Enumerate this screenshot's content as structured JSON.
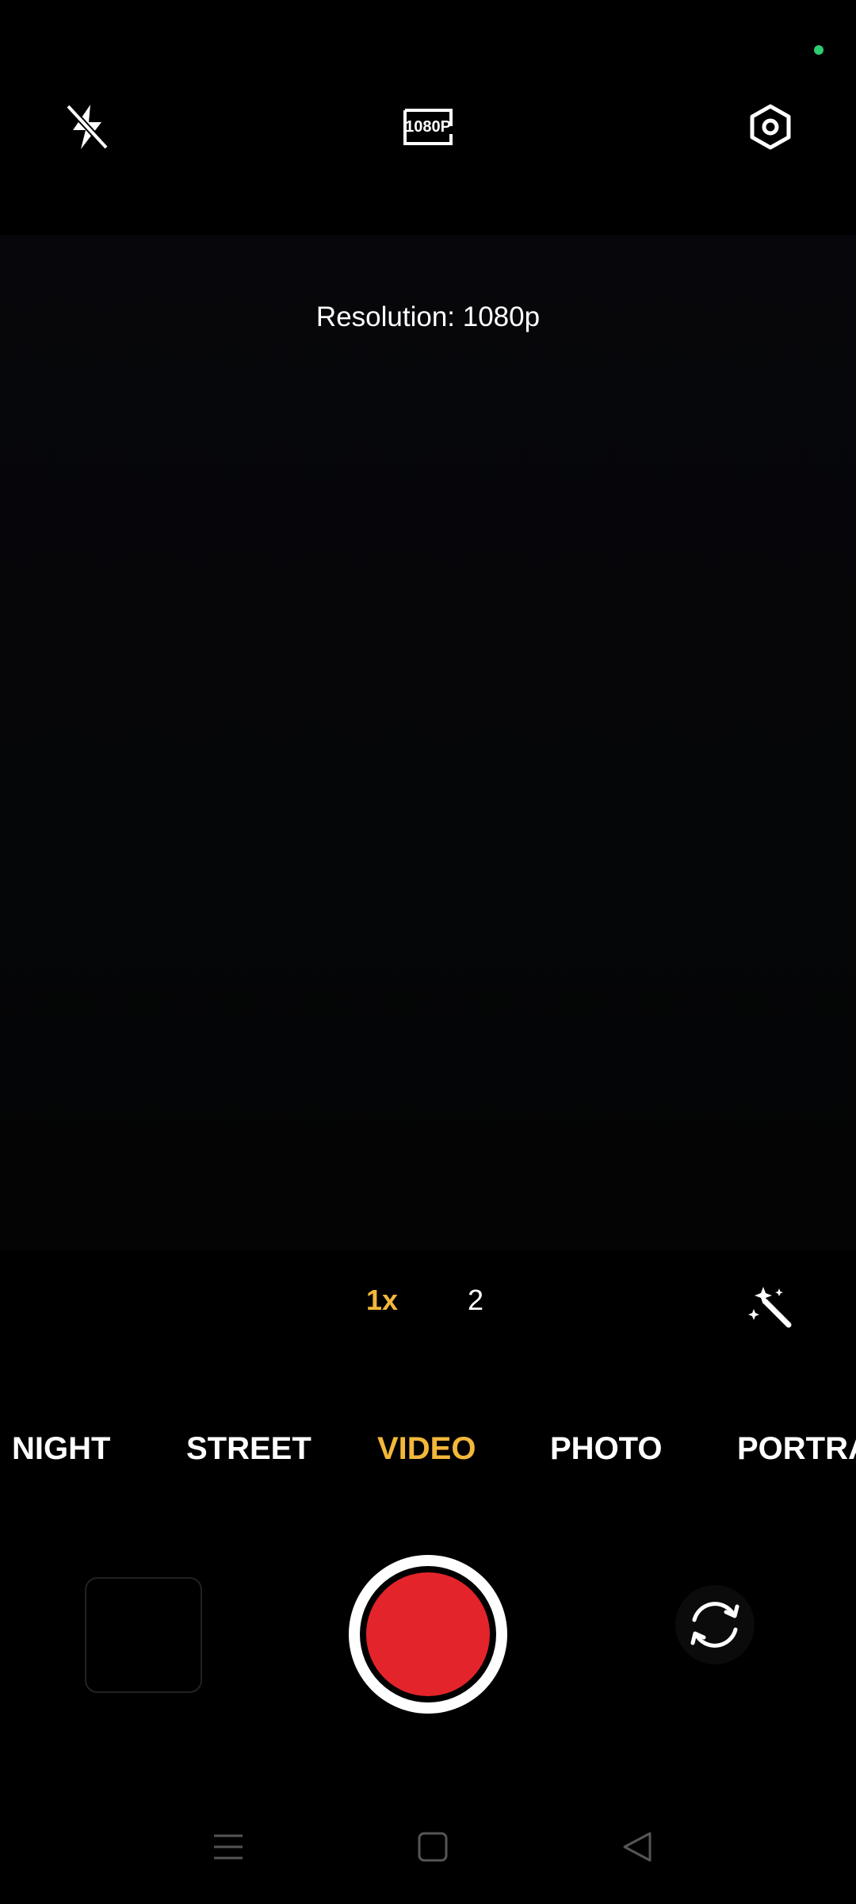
{
  "status": {
    "indicator_color": "#2ecc71"
  },
  "top_bar": {
    "flash_icon": "flash-off-icon",
    "resolution_badge": "1080P",
    "settings_icon": "settings-hexagon-icon"
  },
  "viewfinder": {
    "info_text": "Resolution: 1080p"
  },
  "zoom": {
    "option_1": "1x",
    "option_2": "2",
    "active_color": "#f3b73a"
  },
  "effects": {
    "icon": "magic-wand-icon"
  },
  "modes": [
    {
      "label": "NIGHT",
      "active": false
    },
    {
      "label": "STREET",
      "active": false
    },
    {
      "label": "VIDEO",
      "active": true
    },
    {
      "label": "PHOTO",
      "active": false
    },
    {
      "label": "PORTRA",
      "active": false
    }
  ],
  "controls": {
    "gallery_icon": "gallery-thumbnail",
    "record_color": "#e4242b",
    "flip_icon": "camera-flip-icon"
  },
  "nav": {
    "menu_icon": "menu-icon",
    "home_icon": "home-icon",
    "back_icon": "back-icon"
  }
}
